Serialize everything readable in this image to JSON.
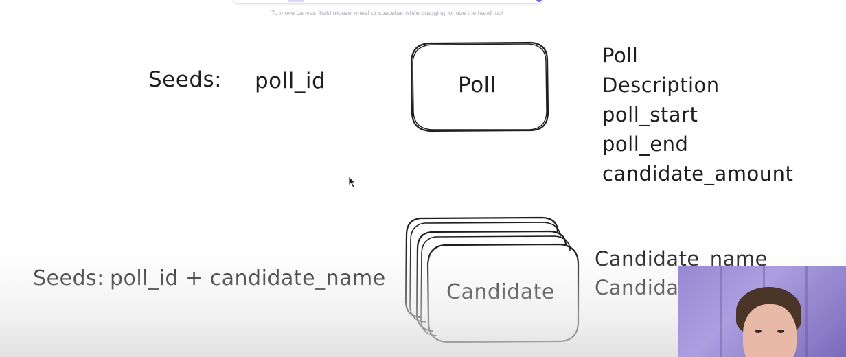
{
  "canvas": {
    "hint": "To move canvas, hold mouse wheel or spacebar while dragging, or use the hand tool"
  },
  "poll": {
    "seeds_label": "Seeds:",
    "seeds_value": "poll_id",
    "box_label": "Poll",
    "attributes": [
      "Poll",
      "Description",
      "poll_start",
      "poll_end",
      "candidate_amount"
    ]
  },
  "candidate": {
    "seeds_label": "Seeds:",
    "seeds_value": "poll_id + candidate_name",
    "box_label": "Candidate",
    "attributes": [
      "Candidate_name",
      "Candida"
    ]
  },
  "colors": {
    "stroke": "#1e1e1e",
    "background": "#ffffff",
    "webcam_bg": "#8f7fcf"
  },
  "icons": {
    "cursor": "arrow-cursor-icon"
  }
}
